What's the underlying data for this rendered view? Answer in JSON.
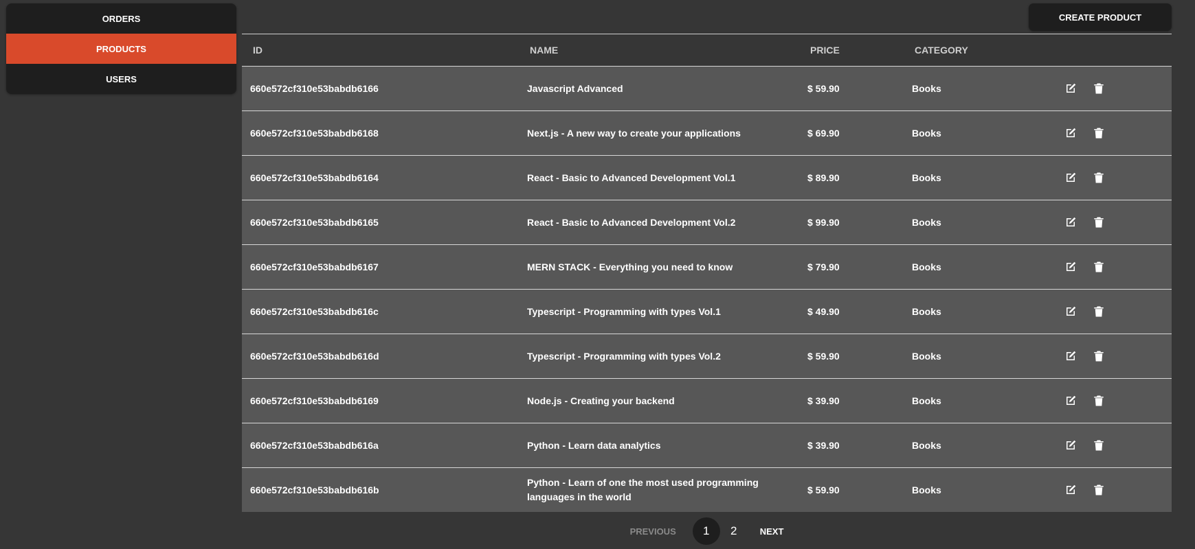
{
  "sidebar": {
    "items": [
      {
        "label": "ORDERS",
        "active": false
      },
      {
        "label": "PRODUCTS",
        "active": true
      },
      {
        "label": "USERS",
        "active": false
      }
    ]
  },
  "toolbar": {
    "create_label": "CREATE PRODUCT"
  },
  "table": {
    "headers": {
      "id": "ID",
      "name": "NAME",
      "price": "PRICE",
      "category": "CATEGORY"
    },
    "rows": [
      {
        "id": "660e572cf310e53babdb6166",
        "name": "Javascript Advanced",
        "price": "$ 59.90",
        "category": "Books"
      },
      {
        "id": "660e572cf310e53babdb6168",
        "name": "Next.js - A new way to create your applications",
        "price": "$ 69.90",
        "category": "Books"
      },
      {
        "id": "660e572cf310e53babdb6164",
        "name": "React - Basic to Advanced Development Vol.1",
        "price": "$ 89.90",
        "category": "Books"
      },
      {
        "id": "660e572cf310e53babdb6165",
        "name": "React - Basic to Advanced Development Vol.2",
        "price": "$ 99.90",
        "category": "Books"
      },
      {
        "id": "660e572cf310e53babdb6167",
        "name": "MERN STACK - Everything you need to know",
        "price": "$ 79.90",
        "category": "Books"
      },
      {
        "id": "660e572cf310e53babdb616c",
        "name": "Typescript - Programming with types Vol.1",
        "price": "$ 49.90",
        "category": "Books"
      },
      {
        "id": "660e572cf310e53babdb616d",
        "name": "Typescript - Programming with types Vol.2",
        "price": "$ 59.90",
        "category": "Books"
      },
      {
        "id": "660e572cf310e53babdb6169",
        "name": "Node.js - Creating your backend",
        "price": "$ 39.90",
        "category": "Books"
      },
      {
        "id": "660e572cf310e53babdb616a",
        "name": "Python - Learn data analytics",
        "price": "$ 39.90",
        "category": "Books"
      },
      {
        "id": "660e572cf310e53babdb616b",
        "name": "Python - Learn of one the most used programming languages in the world",
        "price": "$ 59.90",
        "category": "Books"
      }
    ],
    "row_actions": [
      "edit-icon",
      "trash-icon"
    ]
  },
  "pagination": {
    "previous_label": "PREVIOUS",
    "next_label": "NEXT",
    "pages": [
      "1",
      "2"
    ],
    "current_page": "1"
  },
  "colors": {
    "background": "#363636",
    "panel": "#1e1e1e",
    "accent": "#d94a2b",
    "row": "#575757"
  }
}
